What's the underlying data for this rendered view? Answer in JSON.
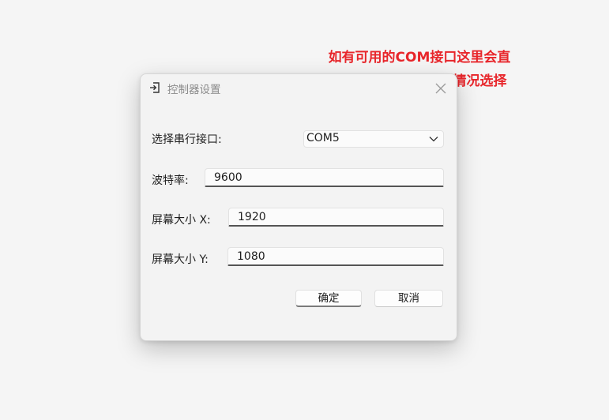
{
  "annotation": {
    "line1": "如有可用的COM接口这里会直",
    "line2": "接列出，请按照实际情况选择"
  },
  "dialog": {
    "title": "控制器设置",
    "title_icon": "login-icon",
    "close_icon": "close-icon",
    "fields": {
      "com": {
        "label": "选择串行接口:",
        "value": "COM5"
      },
      "baud": {
        "label": "波特率:",
        "value": "9600"
      },
      "screen_x": {
        "label": "屏幕大小 X:",
        "value": "1920"
      },
      "screen_y": {
        "label": "屏幕大小 Y:",
        "value": "1080"
      }
    },
    "buttons": {
      "ok": "确定",
      "cancel": "取消"
    }
  },
  "colors": {
    "annotation": "#e8262b",
    "dialog_bg": "#f3f3f3",
    "page_bg": "#f5f5f5"
  }
}
